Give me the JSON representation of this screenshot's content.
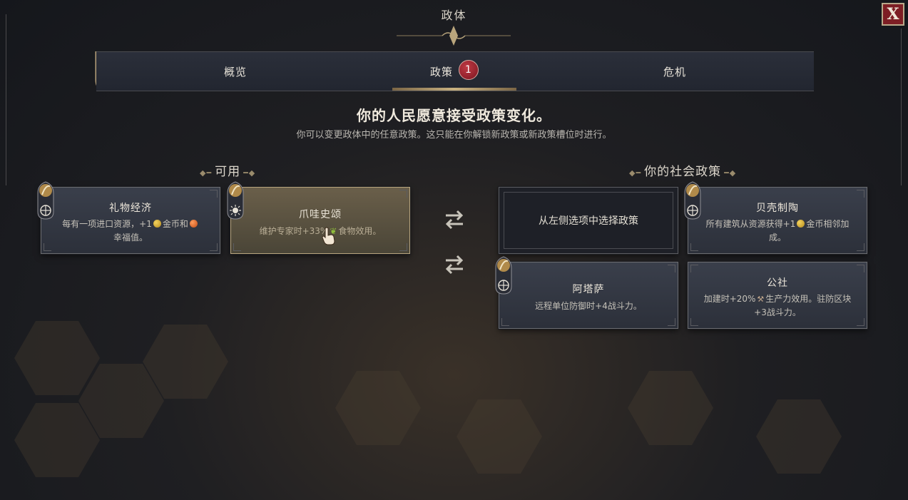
{
  "window": {
    "title": "政体",
    "close_label": "X"
  },
  "tabs": [
    {
      "label": "概览",
      "active": false
    },
    {
      "label": "政策",
      "active": true,
      "badge": "1"
    },
    {
      "label": "危机",
      "active": false
    }
  ],
  "header": {
    "headline": "你的人民愿意接受政策变化。",
    "subline": "你可以变更政体中的任意政策。这只能在你解锁新政策或新政策槽位时进行。"
  },
  "available": {
    "label": "可用",
    "cards": [
      {
        "title": "礼物经济",
        "desc_a": "每有一项进口资源，+1",
        "desc_b": "金币和",
        "desc_c": "幸福值。",
        "icon": "globe-icon",
        "selected": false
      },
      {
        "title": "爪哇史颂",
        "desc_a": "维护专家时+33%",
        "desc_b": "食物效用。",
        "icon": "sun-icon",
        "selected": true
      }
    ]
  },
  "social_policies": {
    "label": "你的社会政策",
    "cards": [
      {
        "empty": true,
        "text": "从左侧选项中选择政策"
      },
      {
        "title": "贝壳制陶",
        "desc_a": "所有建筑从资源获得+1",
        "desc_b": "金币相邻加成。",
        "icon": "globe-icon"
      },
      {
        "title": "阿塔萨",
        "desc_a": "远程单位防御时+4战斗力。",
        "icon": "globe-icon"
      },
      {
        "title": "公社",
        "desc_a": "加建时+20%",
        "desc_b": "生产力效用。驻防区块+3战斗力。"
      }
    ]
  },
  "colors": {
    "accent_gold": "#c8b181",
    "close_red": "#7d1e24",
    "badge_red": "#a82a36",
    "card_bg": "#343843"
  }
}
